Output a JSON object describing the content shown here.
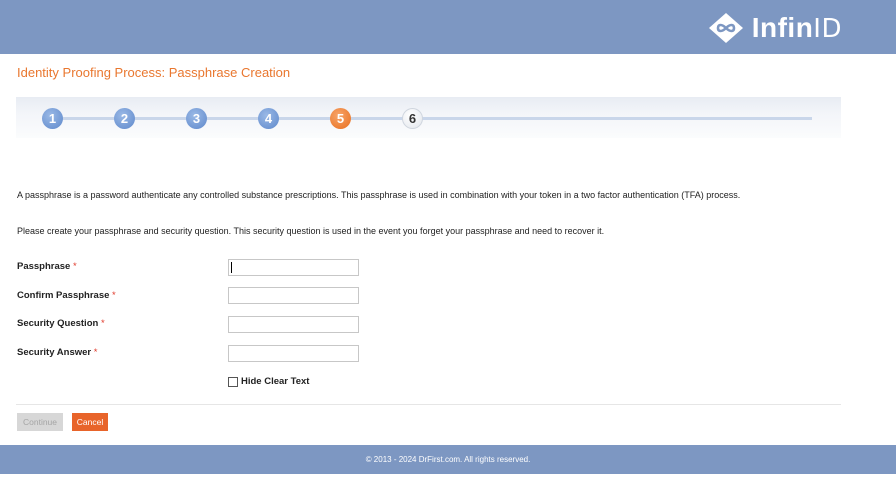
{
  "brand": {
    "name_bold": "Infin",
    "name_light": "ID"
  },
  "page_title": "Identity Proofing Process: Passphrase Creation",
  "steps": [
    {
      "label": "1",
      "state": "done"
    },
    {
      "label": "2",
      "state": "done"
    },
    {
      "label": "3",
      "state": "done"
    },
    {
      "label": "4",
      "state": "done"
    },
    {
      "label": "5",
      "state": "current"
    },
    {
      "label": "6",
      "state": "todo"
    }
  ],
  "description": {
    "para1": "A passphrase is a password authenticate any controlled substance prescriptions. This passphrase is used in combination with your token in a two factor authentication (TFA) process.",
    "para2": "Please create your passphrase and security question. This security question is used in the event you forget your passphrase and need to recover it."
  },
  "form": {
    "required_marker": "*",
    "passphrase": {
      "label": "Passphrase",
      "value": ""
    },
    "confirm_passphrase": {
      "label": "Confirm Passphrase",
      "value": ""
    },
    "security_question": {
      "label": "Security Question",
      "value": ""
    },
    "security_answer": {
      "label": "Security Answer",
      "value": ""
    },
    "hide_clear_text": {
      "label": "Hide Clear Text",
      "checked": false
    }
  },
  "buttons": {
    "continue": "Continue",
    "cancel": "Cancel"
  },
  "footer": "© 2013 - 2024 DrFirst.com. All rights reserved.",
  "colors": {
    "header_bg": "#7d97c2",
    "accent_orange": "#e9772f",
    "step_done": "#6d93cf",
    "cancel_bg": "#e8642a",
    "continue_disabled_bg": "#d7d7d7"
  },
  "icons": {
    "logo": "infinity-icon"
  }
}
